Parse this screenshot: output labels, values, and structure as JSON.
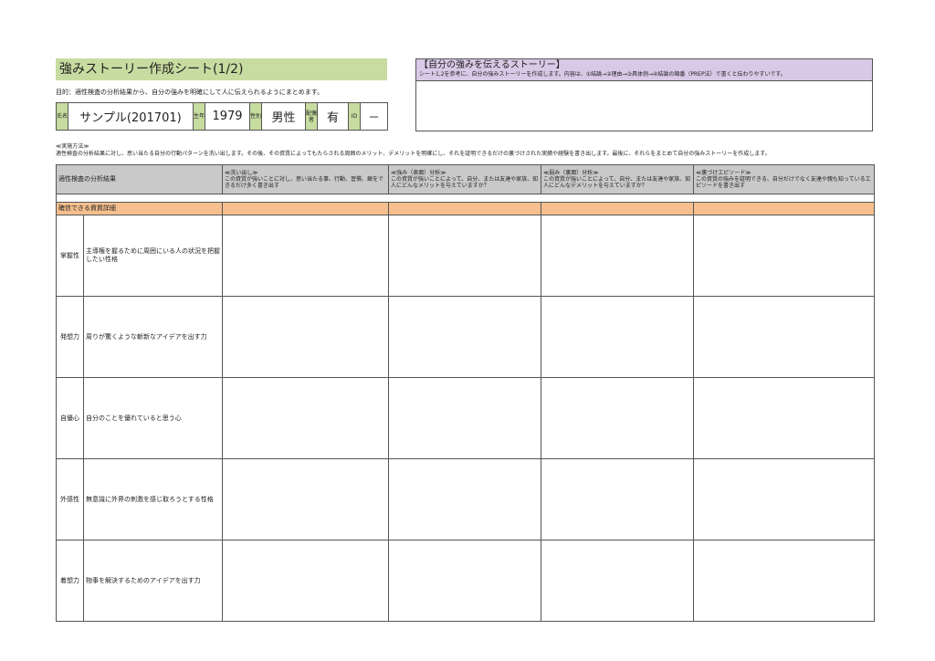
{
  "sheet": {
    "title": "強みストーリー作成シート(1/2)",
    "purpose": "目的：適性検査の分析結果から、自分の強みを明確にして人に伝えられるようにまとめます。"
  },
  "info": {
    "name_label": "氏名",
    "name_value": "サンプル(201701)",
    "birth_label": "生年",
    "birth_value": "1979",
    "gender_label": "性別",
    "gender_value": "男性",
    "spouse_label": "配偶者",
    "spouse_value": "有",
    "id_label": "ID",
    "id_value": "－"
  },
  "story": {
    "title": "【自分の強みを伝えるストーリー】",
    "subtitle": "シート1,2を参考に、自分の強みストーリーを作成します。内容は、①結論→②理由→③具体例→④結論の順番（PREP法）で書くと伝わりやすいです。"
  },
  "method": {
    "title": "≪実施方法≫",
    "description": "適性検査の分析結果に対し、思い当たる自分の行動パターンを洗い出します。その後、その資質によってもたらされる周囲のメリット、デメリットを明確にし、それを証明できるだけの裏づけされた実績や経験を書き出します。最後に、それらをまとめて自分の強みストーリーを作成します。"
  },
  "table": {
    "col0": "適性検査の分析結果",
    "col1_title": "≪洗い出し≫",
    "col1_desc": "この資質が強いことに対し、思い当たる事、行動、習慣、癖をできるだけ多く書き出す",
    "col2_title": "≪強み（表面）分析≫",
    "col2_desc": "この資質が強いことによって、自分、または友達や家族、知人にどんなメリットを与えていますか？",
    "col3_title": "≪弱み（裏面）分析≫",
    "col3_desc": "この資質が強いことによって、自分、または友達や家族、知人にどんなデメリットを与えていますか？",
    "col4_title": "≪裏づけエピソード≫",
    "col4_desc": "この資質の強みを証明できる、自分だけでなく友達や親も知っているエピソードを書き出す",
    "category": "確信できる資質詳細",
    "rows": [
      {
        "key": "掌握性",
        "desc": "主導権を握るために周囲にいる人の状況を把握したい性格"
      },
      {
        "key": "発想力",
        "desc": "周りが驚くような斬新なアイデアを出す力"
      },
      {
        "key": "自優心",
        "desc": "自分のことを優れていると思う心"
      },
      {
        "key": "外感性",
        "desc": "無意識に外界の刺激を感じ取ろうとする性格"
      },
      {
        "key": "着想力",
        "desc": "物事を解決するためのアイデアを出す力"
      }
    ]
  }
}
